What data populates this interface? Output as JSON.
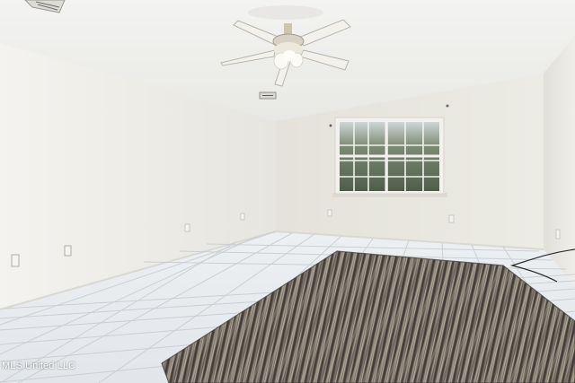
{
  "photo": {
    "watermark": "MLS United LLC",
    "colors": {
      "ceiling": "#eeeeeb",
      "wall_left": "#efeee9",
      "wall_back": "#e9e7df",
      "wall_right": "#e6e5df",
      "floor_tile": "#e8ecef",
      "grout": "#c9ced2",
      "rug_dark": "#4a4540",
      "rug_light": "#a39a8c",
      "window_glass": "#6e7d68",
      "fan_body": "#d8d2c6"
    }
  }
}
